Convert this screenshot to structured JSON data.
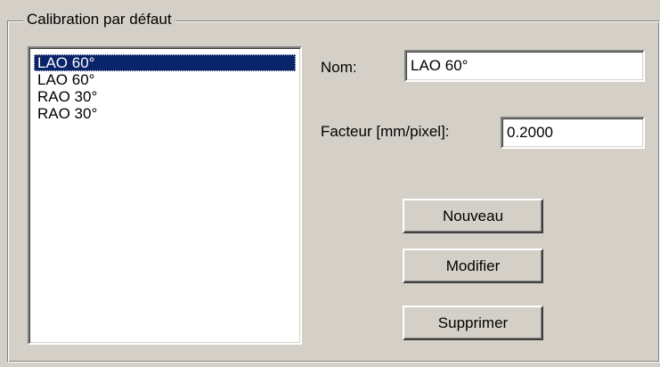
{
  "group": {
    "title": "Calibration par défaut"
  },
  "list": {
    "items": [
      {
        "label": "LAO 60°",
        "selected": true
      },
      {
        "label": "LAO 60°",
        "selected": false
      },
      {
        "label": "RAO 30°",
        "selected": false
      },
      {
        "label": "RAO 30°",
        "selected": false
      }
    ]
  },
  "form": {
    "nom_label": "Nom:",
    "nom_value": "LAO 60°",
    "facteur_label": "Facteur [mm/pixel]:",
    "facteur_value": "0.2000"
  },
  "buttons": {
    "nouveau": "Nouveau",
    "modifier": "Modifier",
    "supprimer": "Supprimer"
  },
  "colors": {
    "background": "#d4d0c8",
    "selection": "#0a246a"
  }
}
